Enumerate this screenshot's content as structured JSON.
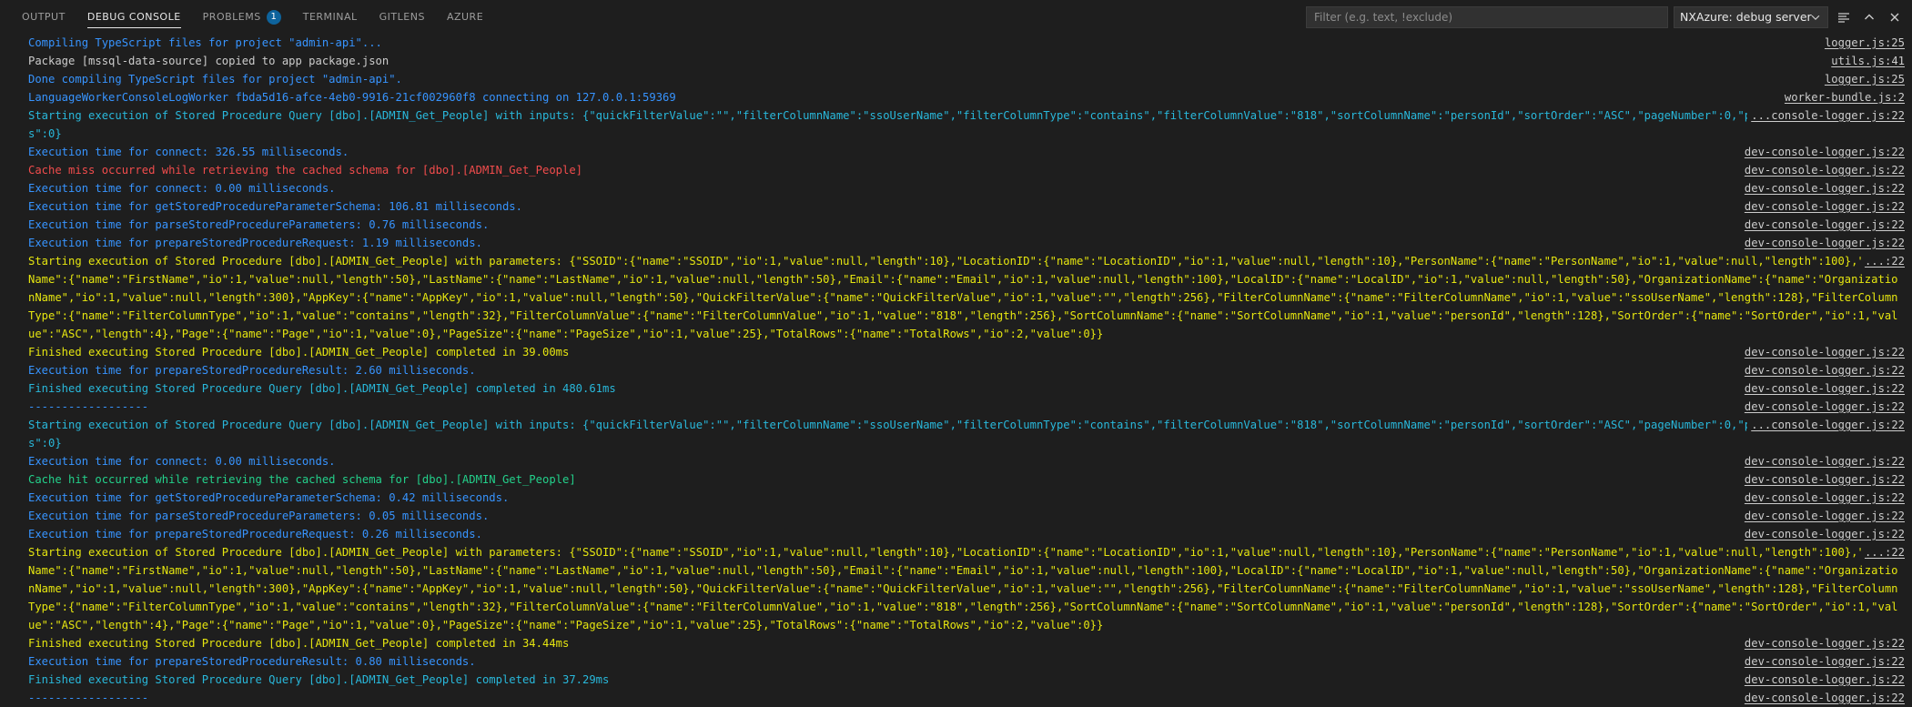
{
  "tabs": [
    {
      "label": "OUTPUT"
    },
    {
      "label": "DEBUG CONSOLE"
    },
    {
      "label": "PROBLEMS",
      "badge": "1"
    },
    {
      "label": "TERMINAL"
    },
    {
      "label": "GITLENS"
    },
    {
      "label": "AZURE"
    }
  ],
  "filter": {
    "placeholder": "Filter (e.g. text, !exclude)",
    "value": ""
  },
  "session": {
    "selected": "NXAzure: debug server"
  },
  "icons": {
    "menu": "list-filter-icon",
    "maximize": "chevron-up-icon",
    "close": "close-icon"
  },
  "colors": {
    "blue": "#3794ff",
    "red": "#f14c4c",
    "yellow": "#e5e510",
    "cyan": "#29b8db",
    "green": "#23d18b"
  },
  "lines": [
    {
      "text": "Compiling TypeScript files for project \"admin-api\"...",
      "source": "logger.js:25",
      "color": "blue"
    },
    {
      "text": " Package [mssql-data-source] copied to app package.json",
      "source": "utils.js:41",
      "color": "white"
    },
    {
      "text": "Done compiling TypeScript files for project \"admin-api\".",
      "source": "logger.js:25",
      "color": "blue"
    },
    {
      "text": "LanguageWorkerConsoleLogWorker fbda5d16-afce-4eb0-9916-21cf002960f8 connecting on 127.0.0.1:59369",
      "source": "worker-bundle.js:2",
      "color": "blue"
    },
    {
      "text": "Starting execution of Stored Procedure Query [dbo].[ADMIN_Get_People] with inputs: {\"quickFilterValue\":\"\",\"filterColumnName\":\"ssoUserName\",\"filterColumnType\":\"contains\",\"filterColumnValue\":\"818\",\"sortColumnName\":\"personId\",\"sortOrder\":\"ASC\",\"pageNumber\":0,\"pageSize\":25,\"totalRows\":0}",
      "source": "...console-logger.js:22",
      "color": "cyan",
      "wrap": true
    },
    {
      "text": "Execution time for connect: 326.55 milliseconds.",
      "source": "dev-console-logger.js:22",
      "color": "blue"
    },
    {
      "text": "Cache miss occurred while retrieving the cached schema for [dbo].[ADMIN_Get_People]",
      "source": "dev-console-logger.js:22",
      "color": "red"
    },
    {
      "text": "Execution time for connect: 0.00 milliseconds.",
      "source": "dev-console-logger.js:22",
      "color": "blue"
    },
    {
      "text": "Execution time for getStoredProcedureParameterSchema: 106.81 milliseconds.",
      "source": "dev-console-logger.js:22",
      "color": "blue"
    },
    {
      "text": "Execution time for parseStoredProcedureParameters: 0.76 milliseconds.",
      "source": "dev-console-logger.js:22",
      "color": "blue"
    },
    {
      "text": "Execution time for prepareStoredProcedureRequest: 1.19 milliseconds.",
      "source": "dev-console-logger.js:22",
      "color": "blue"
    },
    {
      "text": "Starting execution of Stored Procedure [dbo].[ADMIN_Get_People] with parameters: {\"SSOID\":{\"name\":\"SSOID\",\"io\":1,\"value\":null,\"length\":10},\"LocationID\":{\"name\":\"LocationID\",\"io\":1,\"value\":null,\"length\":10},\"PersonName\":{\"name\":\"PersonName\",\"io\":1,\"value\":null,\"length\":100},\"FirstName\":{\"name\":\"FirstName\",\"io\":1,\"value\":null,\"length\":50},\"LastName\":{\"name\":\"LastName\",\"io\":1,\"value\":null,\"length\":50},\"Email\":{\"name\":\"Email\",\"io\":1,\"value\":null,\"length\":100},\"LocalID\":{\"name\":\"LocalID\",\"io\":1,\"value\":null,\"length\":50},\"OrganizationName\":{\"name\":\"OrganizationName\",\"io\":1,\"value\":null,\"length\":300},\"AppKey\":{\"name\":\"AppKey\",\"io\":1,\"value\":null,\"length\":50},\"QuickFilterValue\":{\"name\":\"QuickFilterValue\",\"io\":1,\"value\":\"\",\"length\":256},\"FilterColumnName\":{\"name\":\"FilterColumnName\",\"io\":1,\"value\":\"ssoUserName\",\"length\":128},\"FilterColumnType\":{\"name\":\"FilterColumnType\",\"io\":1,\"value\":\"contains\",\"length\":32},\"FilterColumnValue\":{\"name\":\"FilterColumnValue\",\"io\":1,\"value\":\"818\",\"length\":256},\"SortColumnName\":{\"name\":\"SortColumnName\",\"io\":1,\"value\":\"personId\",\"length\":128},\"SortOrder\":{\"name\":\"SortOrder\",\"io\":1,\"value\":\"ASC\",\"length\":4},\"Page\":{\"name\":\"Page\",\"io\":1,\"value\":0},\"PageSize\":{\"name\":\"PageSize\",\"io\":1,\"value\":25},\"TotalRows\":{\"name\":\"TotalRows\",\"io\":2,\"value\":0}}",
      "source": "...:22",
      "color": "yellow",
      "wrap": true
    },
    {
      "text": "Finished executing Stored Procedure [dbo].[ADMIN_Get_People] completed in 39.00ms",
      "source": "dev-console-logger.js:22",
      "color": "yellow"
    },
    {
      "text": "Execution time for prepareStoredProcedureResult: 2.60 milliseconds.",
      "source": "dev-console-logger.js:22",
      "color": "blue"
    },
    {
      "text": "Finished executing Stored Procedure Query [dbo].[ADMIN_Get_People] completed in 480.61ms",
      "source": "dev-console-logger.js:22",
      "color": "cyan"
    },
    {
      "text": "------------------",
      "source": "dev-console-logger.js:22",
      "color": "blue"
    },
    {
      "text": "Starting execution of Stored Procedure Query [dbo].[ADMIN_Get_People] with inputs: {\"quickFilterValue\":\"\",\"filterColumnName\":\"ssoUserName\",\"filterColumnType\":\"contains\",\"filterColumnValue\":\"818\",\"sortColumnName\":\"personId\",\"sortOrder\":\"ASC\",\"pageNumber\":0,\"pageSize\":25,\"totalRows\":0}",
      "source": "...console-logger.js:22",
      "color": "cyan",
      "wrap": true
    },
    {
      "text": "Execution time for connect: 0.00 milliseconds.",
      "source": "dev-console-logger.js:22",
      "color": "blue"
    },
    {
      "text": "Cache hit occurred while retrieving the cached schema for [dbo].[ADMIN_Get_People]",
      "source": "dev-console-logger.js:22",
      "color": "green"
    },
    {
      "text": "Execution time for getStoredProcedureParameterSchema: 0.42 milliseconds.",
      "source": "dev-console-logger.js:22",
      "color": "blue"
    },
    {
      "text": "Execution time for parseStoredProcedureParameters: 0.05 milliseconds.",
      "source": "dev-console-logger.js:22",
      "color": "blue"
    },
    {
      "text": "Execution time for prepareStoredProcedureRequest: 0.26 milliseconds.",
      "source": "dev-console-logger.js:22",
      "color": "blue"
    },
    {
      "text": "Starting execution of Stored Procedure [dbo].[ADMIN_Get_People] with parameters: {\"SSOID\":{\"name\":\"SSOID\",\"io\":1,\"value\":null,\"length\":10},\"LocationID\":{\"name\":\"LocationID\",\"io\":1,\"value\":null,\"length\":10},\"PersonName\":{\"name\":\"PersonName\",\"io\":1,\"value\":null,\"length\":100},\"FirstName\":{\"name\":\"FirstName\",\"io\":1,\"value\":null,\"length\":50},\"LastName\":{\"name\":\"LastName\",\"io\":1,\"value\":null,\"length\":50},\"Email\":{\"name\":\"Email\",\"io\":1,\"value\":null,\"length\":100},\"LocalID\":{\"name\":\"LocalID\",\"io\":1,\"value\":null,\"length\":50},\"OrganizationName\":{\"name\":\"OrganizationName\",\"io\":1,\"value\":null,\"length\":300},\"AppKey\":{\"name\":\"AppKey\",\"io\":1,\"value\":null,\"length\":50},\"QuickFilterValue\":{\"name\":\"QuickFilterValue\",\"io\":1,\"value\":\"\",\"length\":256},\"FilterColumnName\":{\"name\":\"FilterColumnName\",\"io\":1,\"value\":\"ssoUserName\",\"length\":128},\"FilterColumnType\":{\"name\":\"FilterColumnType\",\"io\":1,\"value\":\"contains\",\"length\":32},\"FilterColumnValue\":{\"name\":\"FilterColumnValue\",\"io\":1,\"value\":\"818\",\"length\":256},\"SortColumnName\":{\"name\":\"SortColumnName\",\"io\":1,\"value\":\"personId\",\"length\":128},\"SortOrder\":{\"name\":\"SortOrder\",\"io\":1,\"value\":\"ASC\",\"length\":4},\"Page\":{\"name\":\"Page\",\"io\":1,\"value\":0},\"PageSize\":{\"name\":\"PageSize\",\"io\":1,\"value\":25},\"TotalRows\":{\"name\":\"TotalRows\",\"io\":2,\"value\":0}}",
      "source": "...:22",
      "color": "yellow",
      "wrap": true
    },
    {
      "text": "Finished executing Stored Procedure [dbo].[ADMIN_Get_People] completed in 34.44ms",
      "source": "dev-console-logger.js:22",
      "color": "yellow"
    },
    {
      "text": "Execution time for prepareStoredProcedureResult: 0.80 milliseconds.",
      "source": "dev-console-logger.js:22",
      "color": "blue"
    },
    {
      "text": "Finished executing Stored Procedure Query [dbo].[ADMIN_Get_People] completed in 37.29ms",
      "source": "dev-console-logger.js:22",
      "color": "cyan"
    },
    {
      "text": "------------------",
      "source": "dev-console-logger.js:22",
      "color": "blue"
    }
  ]
}
